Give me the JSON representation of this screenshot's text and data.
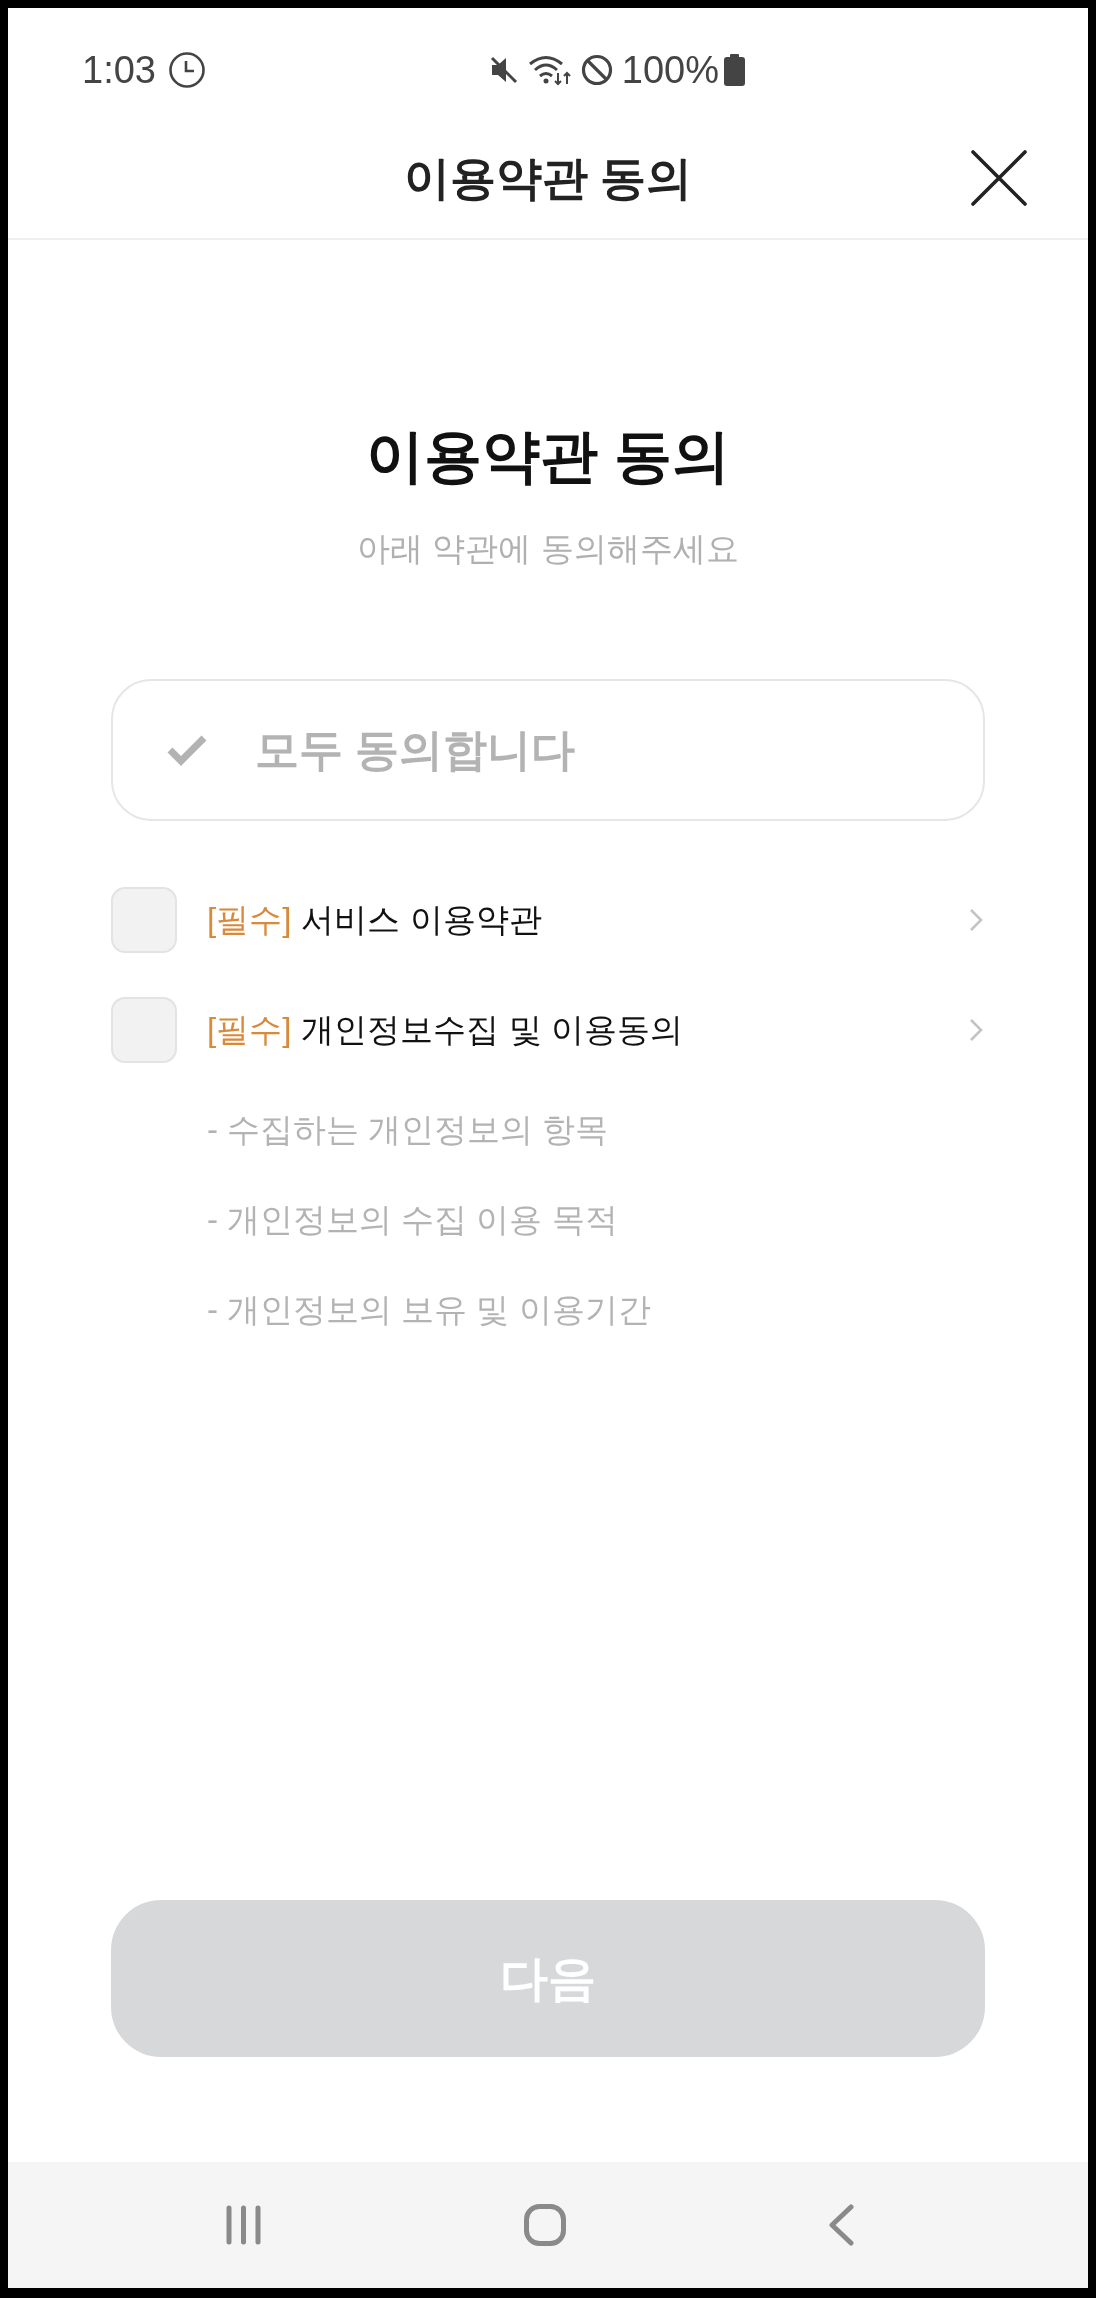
{
  "status_bar": {
    "time": "1:03",
    "battery": "100%"
  },
  "header": {
    "title": "이용약관 동의"
  },
  "intro": {
    "title": "이용약관 동의",
    "subtitle": "아래 약관에 동의해주세요"
  },
  "agree_all": {
    "label": "모두 동의합니다",
    "checked": false
  },
  "terms": [
    {
      "tag": "[필수]",
      "label": "서비스 이용약관",
      "checked": false
    },
    {
      "tag": "[필수]",
      "label": "개인정보수집 및 이용동의",
      "checked": false,
      "details": [
        "- 수집하는 개인정보의 항목",
        "- 개인정보의 수집 이용 목적",
        "- 개인정보의 보유 및 이용기간"
      ]
    }
  ],
  "next_button": {
    "label": "다음",
    "disabled": true
  }
}
